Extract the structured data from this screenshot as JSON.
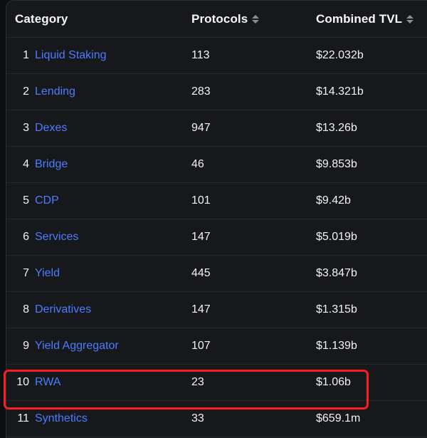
{
  "table": {
    "columns": {
      "category": "Category",
      "protocols": "Protocols",
      "tvl": "Combined TVL"
    },
    "sort_icon_name": "sort-arrows-icon",
    "rows": [
      {
        "rank": "1",
        "category": "Liquid Staking",
        "protocols": "113",
        "tvl": "$22.032b",
        "highlighted": false
      },
      {
        "rank": "2",
        "category": "Lending",
        "protocols": "283",
        "tvl": "$14.321b",
        "highlighted": false
      },
      {
        "rank": "3",
        "category": "Dexes",
        "protocols": "947",
        "tvl": "$13.26b",
        "highlighted": false
      },
      {
        "rank": "4",
        "category": "Bridge",
        "protocols": "46",
        "tvl": "$9.853b",
        "highlighted": false
      },
      {
        "rank": "5",
        "category": "CDP",
        "protocols": "101",
        "tvl": "$9.42b",
        "highlighted": false
      },
      {
        "rank": "6",
        "category": "Services",
        "protocols": "147",
        "tvl": "$5.019b",
        "highlighted": false
      },
      {
        "rank": "7",
        "category": "Yield",
        "protocols": "445",
        "tvl": "$3.847b",
        "highlighted": false
      },
      {
        "rank": "8",
        "category": "Derivatives",
        "protocols": "147",
        "tvl": "$1.315b",
        "highlighted": false
      },
      {
        "rank": "9",
        "category": "Yield Aggregator",
        "protocols": "107",
        "tvl": "$1.139b",
        "highlighted": false
      },
      {
        "rank": "10",
        "category": "RWA",
        "protocols": "23",
        "tvl": "$1.06b",
        "highlighted": true
      },
      {
        "rank": "11",
        "category": "Synthetics",
        "protocols": "33",
        "tvl": "$659.1m",
        "highlighted": false
      }
    ]
  },
  "colors": {
    "background": "#0d0e12",
    "panel": "#17181c",
    "row_divider": "#26272d",
    "link": "#4a7dff",
    "text": "#f2f3f5",
    "header_text": "#f7f8f8",
    "sort_icon": "#8d8f98",
    "annotation": "#f81f1f"
  }
}
